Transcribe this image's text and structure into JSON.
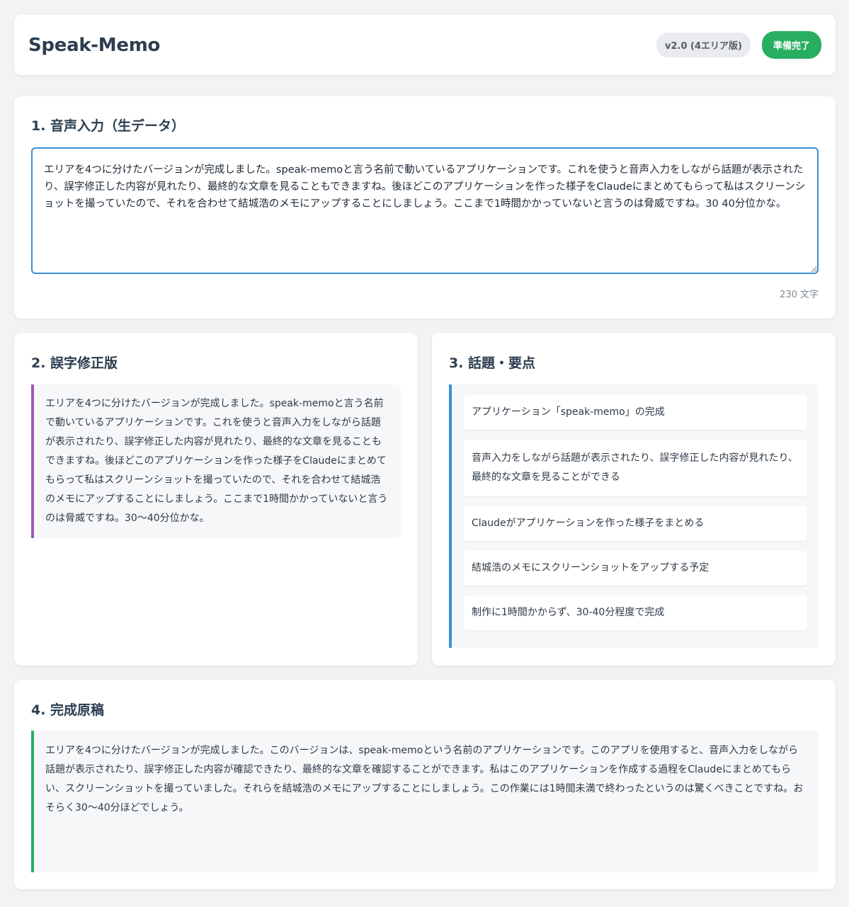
{
  "header": {
    "title": "Speak-Memo",
    "version": "v2.0 (4エリア版)",
    "status": "準備完了"
  },
  "colors": {
    "accent_blue": "#3b8fd9",
    "accent_purple": "#9b59b6",
    "accent_green": "#27ae60"
  },
  "sections": {
    "input": {
      "title": "1. 音声入力（生データ）",
      "raw_text": "エリアを4つに分けたバージョンが完成しました。speak-memoと言う名前で動いているアプリケーションです。これを使うと音声入力をしながら話題が表示されたり、誤字修正した内容が見れたり、最終的な文章を見ることもできますね。後ほどこのアプリケーションを作った様子をClaudeにまとめてもらって私はスクリーンショットを撮っていたので、それを合わせて結城浩のメモにアップすることにしましょう。ここまで1時間かかっていないと言うのは脅威ですね。30 40分位かな。",
      "char_count": "230 文字"
    },
    "corrected": {
      "title": "2. 誤字修正版",
      "text": "エリアを4つに分けたバージョンが完成しました。speak-memoと言う名前で動いているアプリケーションです。これを使うと音声入力をしながら話題が表示されたり、誤字修正した内容が見れたり、最終的な文章を見ることもできますね。後ほどこのアプリケーションを作った様子をClaudeにまとめてもらって私はスクリーンショットを撮っていたので、それを合わせて結城浩のメモにアップすることにしましょう。ここまで1時間かかっていないと言うのは脅威ですね。30〜40分位かな。"
    },
    "topics": {
      "title": "3. 話題・要点",
      "items": [
        "アプリケーション「speak-memo」の完成",
        "音声入力をしながら話題が表示されたり、誤字修正した内容が見れたり、最終的な文章を見ることができる",
        "Claudeがアプリケーションを作った様子をまとめる",
        "結城浩のメモにスクリーンショットをアップする予定",
        "制作に1時間かからず、30-40分程度で完成"
      ]
    },
    "final": {
      "title": "4. 完成原稿",
      "text": "エリアを4つに分けたバージョンが完成しました。このバージョンは、speak-memoという名前のアプリケーションです。このアプリを使用すると、音声入力をしながら話題が表示されたり、誤字修正した内容が確認できたり、最終的な文章を確認することができます。私はこのアプリケーションを作成する過程をClaudeにまとめてもらい、スクリーンショットを撮っていました。それらを結城浩のメモにアップすることにしましょう。この作業には1時間未満で終わったというのは驚くべきことですね。おそらく30〜40分ほどでしょう。"
    }
  }
}
